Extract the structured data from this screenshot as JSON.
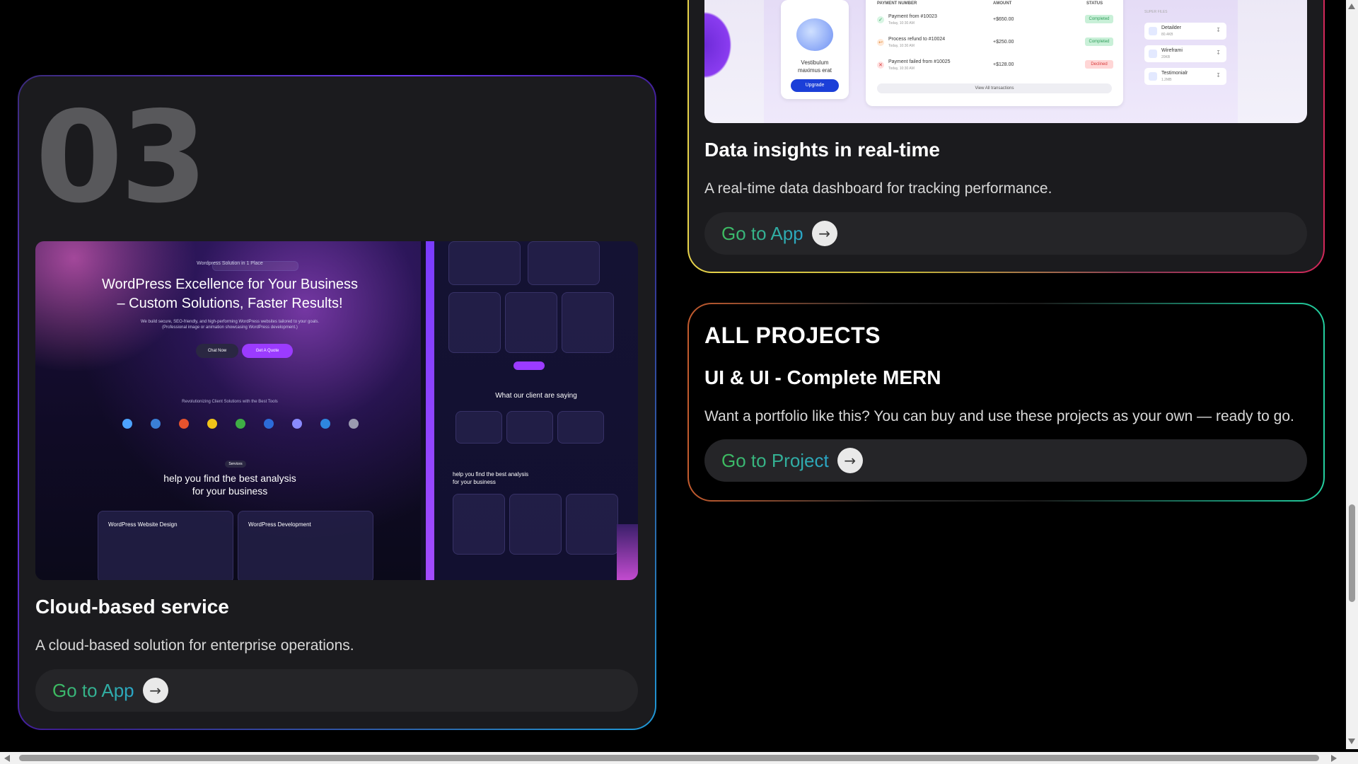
{
  "left_card": {
    "number": "03",
    "preview": {
      "badge": "Wordpress Solution in 1 Place",
      "headline_line1": "WordPress Excellence for Your Business",
      "headline_line2": "– Custom Solutions, Faster Results!",
      "subtext_line1": "We build secure, SEO-friendly, and high-performing WordPress websites tailored to your goals.",
      "subtext_line2": "(Professional image or animation showcasing WordPress development.)",
      "chat_label": "Chat Now",
      "quote_label": "Get A Quote",
      "tools_label": "Revolutionizing Client Solutions with the Best Tools",
      "services_badge": "Services",
      "analysis_line1": "help you find the best analysis",
      "analysis_line2": "for your business",
      "service1_title": "WordPress Website Design",
      "service2_title": "WordPress Development",
      "client_heading": "What our client are saying",
      "side_analysis_line1": "help you find the best analysis",
      "side_analysis_line2": "for your business"
    },
    "title": "Cloud-based service",
    "description": "A cloud-based solution for enterprise operations.",
    "button_label": "Go to App"
  },
  "right_top_card": {
    "preview": {
      "col_payment": "PAYMENT NUMBER",
      "col_amount": "AMOUNT",
      "col_status": "STATUS",
      "rows": [
        {
          "label": "Payment from #10023",
          "date": "Today, 10:30 AM",
          "amount": "+$650.00",
          "status": "Completed"
        },
        {
          "label": "Process refund to #10024",
          "date": "Today, 10:30 AM",
          "amount": "+$250.00",
          "status": "Completed"
        },
        {
          "label": "Payment failed from #10025",
          "date": "Today, 10:30 AM",
          "amount": "+$128.00",
          "status": "Declined"
        }
      ],
      "view_all": "View All transactions",
      "promo_text_line1": "Vestibulum",
      "promo_text_line2": "maximus erat",
      "upgrade_label": "Upgrade",
      "files_heading": "SUPER FILES",
      "files": [
        {
          "name": "Detailder",
          "size": "80.4KB"
        },
        {
          "name": "Wireframi",
          "size": "20KB"
        },
        {
          "name": "Testimonialr",
          "size": "1.2MB"
        }
      ]
    },
    "title": "Data insights in real-time",
    "description": "A real-time data dashboard for tracking performance.",
    "button_label": "Go to App"
  },
  "right_bottom_card": {
    "heading": "ALL PROJECTS",
    "title": "UI & UI - Complete MERN",
    "description": "Want a portfolio like this? You can buy and use these projects as your own — ready to go.",
    "button_label": "Go to Project"
  },
  "colors": {
    "background": "#000000",
    "card": "#1b1b1e",
    "button": "#252528",
    "gradient_green": "#3ebc5d",
    "gradient_blue": "#2aa6c8",
    "number": "#58585b"
  },
  "icons": {
    "arrow": "arrow-right-icon",
    "scroll_up": "scroll-up-arrow-icon",
    "scroll_down": "scroll-down-arrow-icon",
    "scroll_left": "scroll-left-arrow-icon",
    "scroll_right": "scroll-right-arrow-icon"
  }
}
